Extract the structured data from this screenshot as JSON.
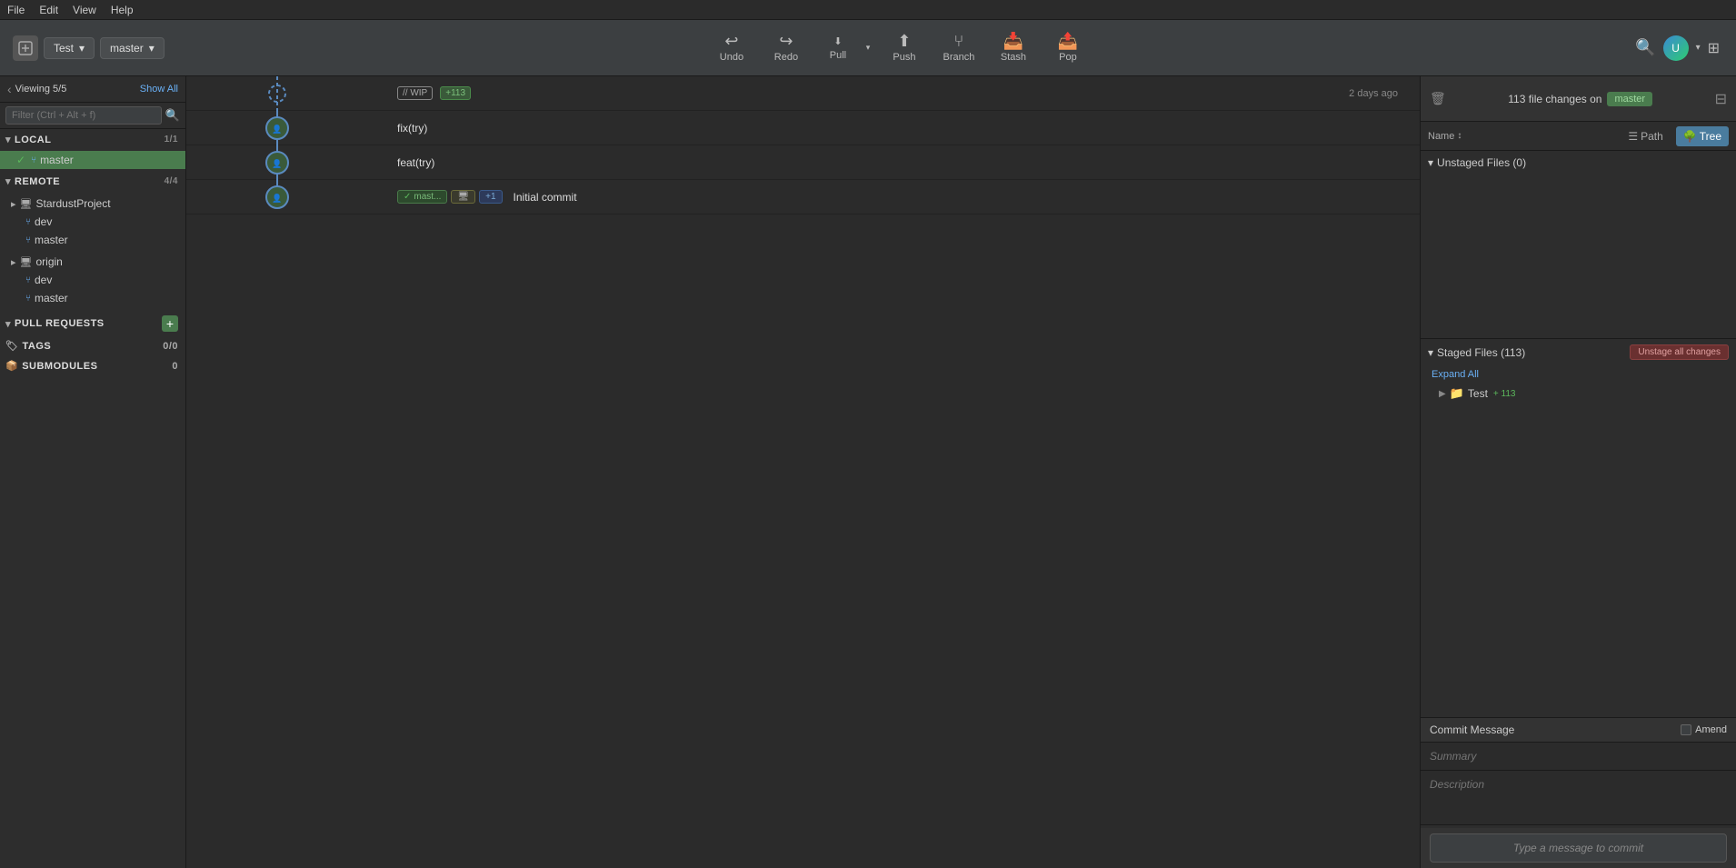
{
  "menubar": {
    "items": [
      "File",
      "Edit",
      "View",
      "Help"
    ]
  },
  "toolbar": {
    "repo": "Test",
    "branch": "master",
    "undo_label": "Undo",
    "redo_label": "Redo",
    "pull_label": "Pull",
    "push_label": "Push",
    "branch_label": "Branch",
    "stash_label": "Stash",
    "pop_label": "Pop"
  },
  "sidebar": {
    "viewing_text": "Viewing 5/5",
    "show_all": "Show All",
    "filter_placeholder": "Filter (Ctrl + Alt + f)",
    "local": {
      "label": "LOCAL",
      "count": "1/1",
      "branches": [
        {
          "name": "master",
          "active": true
        }
      ]
    },
    "remote": {
      "label": "REMOTE",
      "count": "4/4",
      "groups": [
        {
          "name": "StardustProject",
          "branches": [
            "dev",
            "master"
          ]
        },
        {
          "name": "origin",
          "branches": [
            "dev",
            "master"
          ]
        }
      ]
    },
    "pull_requests": {
      "label": "PULL REQUESTS"
    },
    "tags": {
      "label": "TAGS",
      "count": "0/0"
    },
    "submodules": {
      "label": "SUBMODULES",
      "count": "0"
    }
  },
  "graph": {
    "commits": [
      {
        "id": 1,
        "message": "// WIP",
        "badge": "+113",
        "badge_type": "wip",
        "time": "2 days ago",
        "has_avatar": true,
        "branch_tags": [],
        "branch_tag_type": "wip"
      },
      {
        "id": 2,
        "message": "fix(try)",
        "time": "",
        "has_avatar": true,
        "branch_tags": [],
        "branch_tag_type": "none"
      },
      {
        "id": 3,
        "message": "feat(try)",
        "time": "",
        "has_avatar": true,
        "branch_tags": [],
        "branch_tag_type": "none"
      },
      {
        "id": 4,
        "message": "Initial commit",
        "time": "",
        "has_avatar": true,
        "branch_tags": [
          "mast...",
          "+1"
        ],
        "branch_tag_type": "master"
      }
    ]
  },
  "right_panel": {
    "file_changes_text": "113 file changes on",
    "master_badge": "master",
    "name_label": "Name",
    "path_label": "Path",
    "tree_label": "Tree",
    "unstaged_label": "Unstaged Files (0)",
    "staged_label": "Staged Files (113)",
    "unstage_all_btn": "Unstage all changes",
    "expand_all": "Expand All",
    "test_folder": "Test",
    "test_count": "+113"
  },
  "commit_message": {
    "label": "Commit Message",
    "amend_label": "Amend",
    "summary_placeholder": "Summary",
    "description_placeholder": "Description",
    "commit_btn_placeholder": "Type a message to commit"
  }
}
